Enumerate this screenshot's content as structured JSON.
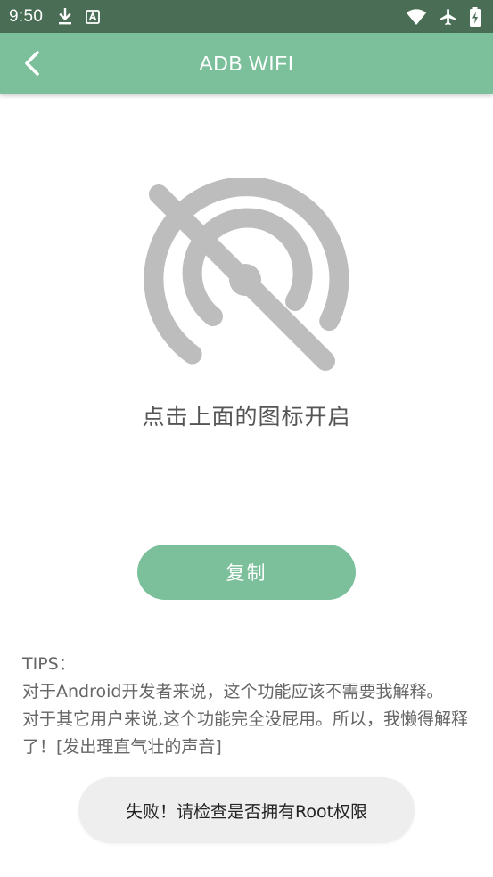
{
  "status_bar": {
    "time": "9:50",
    "left_icons": [
      "download-icon",
      "text-a-icon"
    ],
    "right_icons": [
      "wifi-icon",
      "airplane-mode-icon",
      "battery-charging-icon"
    ]
  },
  "app_bar": {
    "title": "ADB WIFI",
    "back_icon": "chevron-left-icon"
  },
  "main": {
    "wifi_icon": "wifi-off-icon",
    "hint": "点击上面的图标开启",
    "copy_label": "复制"
  },
  "tips": {
    "title": "TIPS：",
    "line1": "对于Android开发者来说，这个功能应该不需要我解释。",
    "line2": "对于其它用户来说,这个功能完全没屁用。所以，我懒得解释了！[发出理直气壮的声音]"
  },
  "toast": {
    "message": "失败！请检查是否拥有Root权限"
  },
  "colors": {
    "status_bar": "#4a6e55",
    "accent": "#7bc09b",
    "icon_gray": "#bdbdbd",
    "toast_bg": "#eeeeee"
  }
}
